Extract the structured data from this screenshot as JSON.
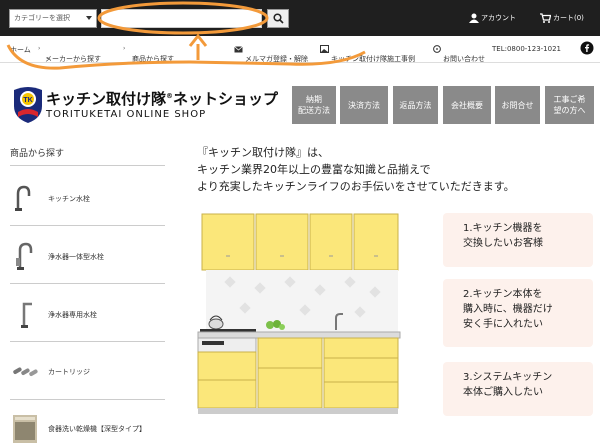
{
  "header": {
    "category_select": "カテゴリーを選択",
    "search_placeholder": "",
    "account": "アカウント",
    "cart": "カート(0)"
  },
  "nav": {
    "home": "ホーム",
    "by_maker": "メーカーから探す",
    "by_product": "商品から探す",
    "newsletter": "メルマガ登録・解除",
    "cases": "キッチン取付け隊施工事例",
    "contact": "お問い合わせ",
    "tel": "TEL:0800-123-1021"
  },
  "logo": {
    "title_pre": "キッチン取付け隊",
    "registered": "®",
    "title_post": "ネットショップ",
    "subtitle": "TORITUKETAI ONLINE SHOP",
    "badge": "TK"
  },
  "menu_buttons": [
    {
      "line1": "納期",
      "line2": "配送方法"
    },
    {
      "line1": "決済方法",
      "line2": ""
    },
    {
      "line1": "返品方法",
      "line2": ""
    },
    {
      "line1": "会社概要",
      "line2": ""
    },
    {
      "line1": "お問合せ",
      "line2": ""
    },
    {
      "line1": "工事ご希",
      "line2": "望の方へ"
    }
  ],
  "sidebar": {
    "title": "商品から探す",
    "items": [
      {
        "label": "キッチン水栓"
      },
      {
        "label": "浄水器一体型水栓"
      },
      {
        "label": "浄水器専用水栓"
      },
      {
        "label": "カートリッジ"
      },
      {
        "label": "食器洗い乾燥機【深型タイプ】"
      }
    ]
  },
  "intro": {
    "line1": "『キッチン取付け隊』は、",
    "line2": "キッチン業界20年以上の豊富な知識と品揃えで",
    "line3": "より充実したキッチンライフのお手伝いをさせていただきます。"
  },
  "options": [
    {
      "line1": "1.キッチン機器を",
      "line2": "交換したいお客様",
      "line3": ""
    },
    {
      "line1": "2.キッチン本体を",
      "line2": "購入時に、機器だけ",
      "line3": "安く手に入れたい"
    },
    {
      "line1": "3.システムキッチン",
      "line2": "本体ご購入したい",
      "line3": ""
    }
  ],
  "colors": {
    "topbar": "#1f1f1f",
    "annotation": "#f39a3a",
    "menu_button": "#8a8a8a",
    "option_bg": "#fdf1ec",
    "cabinet": "#fbe77a"
  }
}
